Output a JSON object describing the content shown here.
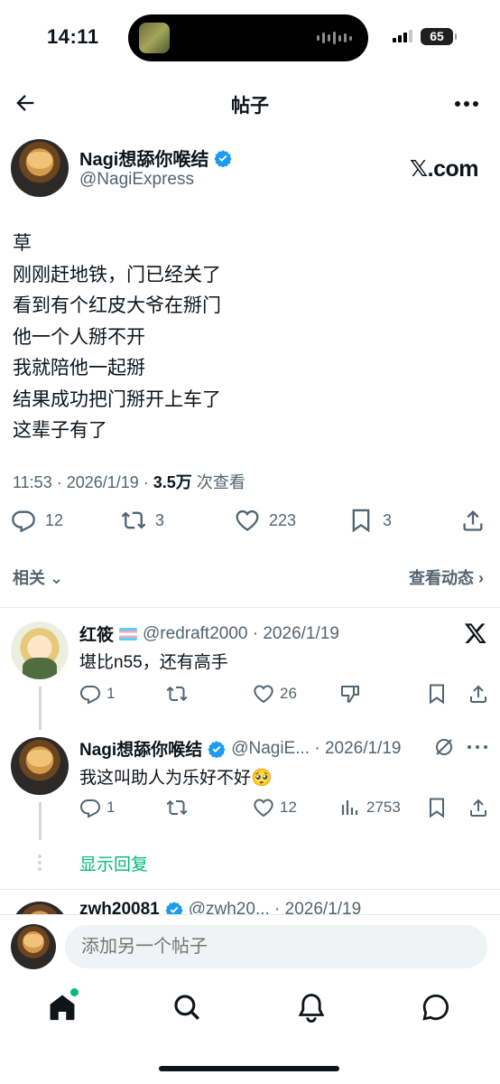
{
  "status_bar": {
    "time": "14:11",
    "battery": "65"
  },
  "nav": {
    "title": "帖子"
  },
  "post": {
    "author_name": "Nagi想舔你喉结",
    "author_handle": "@NagiExpress",
    "watermark": "𝕏.com",
    "lines": [
      "草",
      "刚刚赶地铁，门已经关了",
      "看到有个红皮大爷在掰门",
      "他一个人掰不开",
      "我就陪他一起掰",
      "结果成功把门掰开上车了",
      "这辈子有了"
    ],
    "time_date": "11:53 · 2026/1/19 · ",
    "views": "3.5万",
    "views_label": " 次查看",
    "replies": "12",
    "reposts": "3",
    "likes": "223",
    "bookmarks": "3"
  },
  "related_label": "相关",
  "activity_label": "查看动态",
  "replies": [
    {
      "name": "红筱",
      "handle": "@redraft2000 · 2026/1/19",
      "text": "堪比n55，还有高手",
      "reply_count": "1",
      "like_count": "26"
    },
    {
      "name": "Nagi想舔你喉结",
      "handle": "@NagiE... · 2026/1/19",
      "text": "我这叫助人为乐好不好🥺",
      "reply_count": "1",
      "like_count": "12",
      "view_count": "2753"
    },
    {
      "name": "zwh20081",
      "handle": "@zwh20... · 2026/1/19"
    }
  ],
  "show_replies": "显示回复",
  "compose": {
    "placeholder": "添加另一个帖子"
  },
  "colors": {
    "accent_green": "#00ba7c",
    "verified_blue": "#1d9bf0",
    "muted": "#536471"
  }
}
